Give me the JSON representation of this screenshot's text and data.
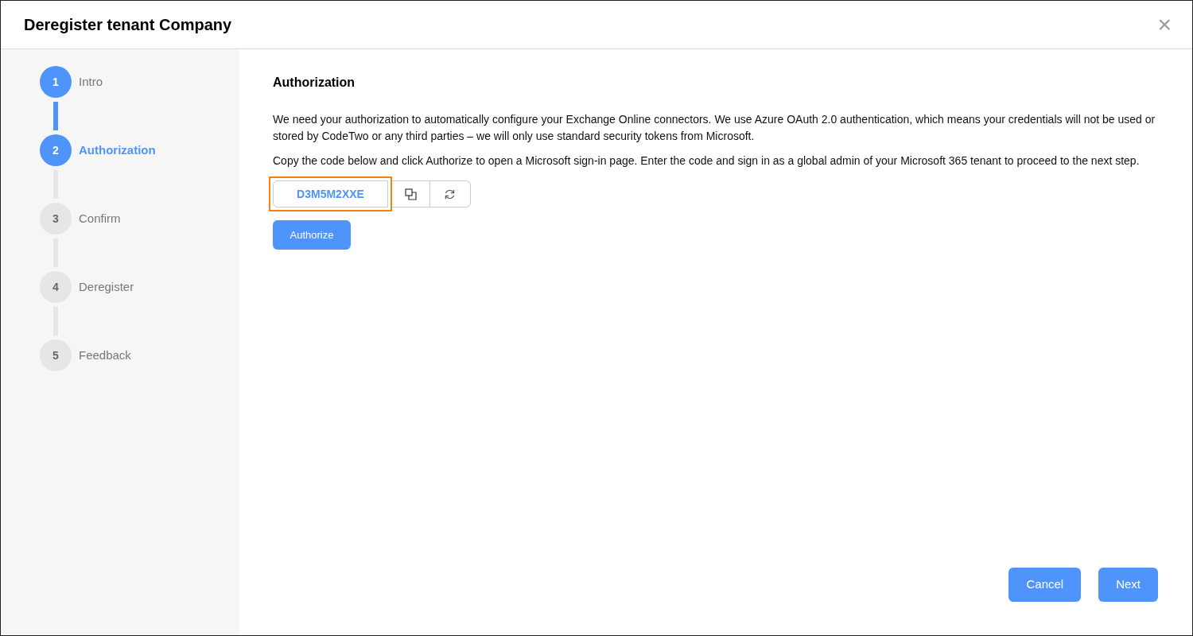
{
  "window": {
    "title": "Deregister tenant Company",
    "close": "×"
  },
  "steps": [
    {
      "number": "1",
      "label": "Intro",
      "completed": true,
      "selected": false
    },
    {
      "number": "2",
      "label": "Authorization",
      "completed": false,
      "selected": true
    },
    {
      "number": "3",
      "label": "Confirm",
      "completed": false,
      "selected": false
    },
    {
      "number": "4",
      "label": "Deregister",
      "completed": false,
      "selected": false
    },
    {
      "number": "5",
      "label": "Feedback",
      "completed": false,
      "selected": false
    }
  ],
  "content": {
    "heading": "Authorization",
    "paragraphs": [
      "We need your authorization to automatically configure your Exchange Online connectors. We use Azure OAuth 2.0 authentication, which means your credentials will not be used or stored by CodeTwo or any third parties – we will only use standard security tokens from Microsoft.",
      "Copy the code below and click Authorize to open a Microsoft sign-in page. Enter the code and sign in as a global admin of your Microsoft 365 tenant to proceed to the next step."
    ],
    "code": {
      "value": "D3M5M2XXE",
      "highlighted": true
    },
    "authorize_button": "Authorize"
  },
  "footer_buttons": [
    "Cancel",
    "Next"
  ]
}
